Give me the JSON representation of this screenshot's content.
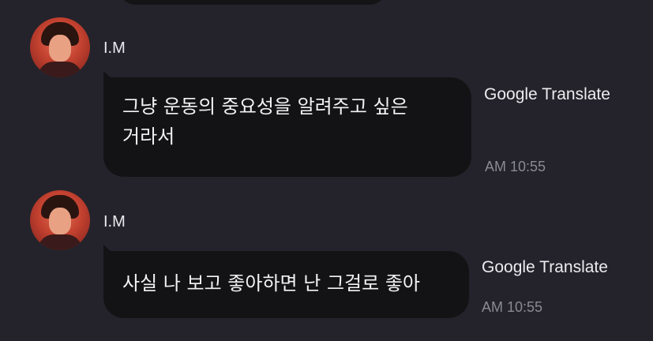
{
  "messages": [
    {
      "sender": "I.M",
      "text_lines": [
        "그냥 운동의 중요성을 알려주고 싶은",
        "거라서"
      ],
      "translate_label": "Google Translate",
      "time": "AM 10:55"
    },
    {
      "sender": "I.M",
      "text_lines": [
        "사실 나 보고 좋아하면 난 그걸로 좋아"
      ],
      "translate_label": "Google Translate",
      "time": "AM 10:55"
    }
  ],
  "colors": {
    "background": "#24232b",
    "bubble": "#131315",
    "timestamp": "#8a8a93"
  }
}
